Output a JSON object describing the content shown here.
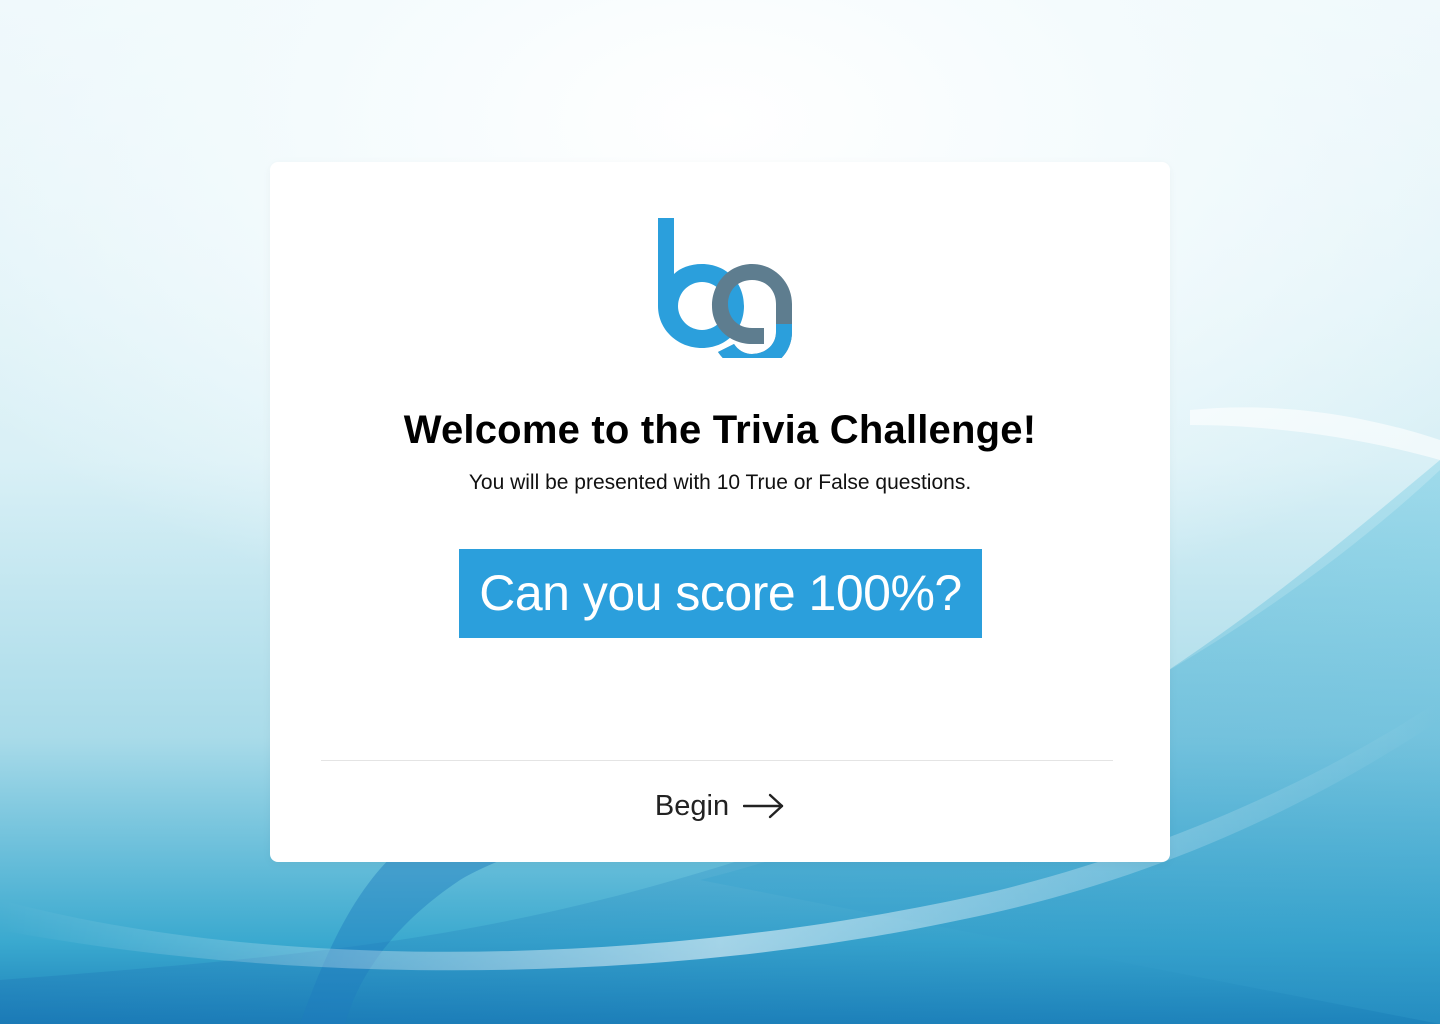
{
  "welcome": {
    "title": "Welcome to the Trivia Challenge!",
    "subtitle": "You will be presented with 10 True or False questions.",
    "highlight": "Can you score 100%?"
  },
  "footer": {
    "begin_label": "Begin",
    "begin_icon": "arrow-right-icon"
  },
  "logo": {
    "name": "bg-logo",
    "text": "bg"
  },
  "colors": {
    "accent": "#2b9fdc",
    "logo_blue": "#2b9fdc",
    "logo_slate": "#5e7d8f",
    "card": "#ffffff"
  }
}
